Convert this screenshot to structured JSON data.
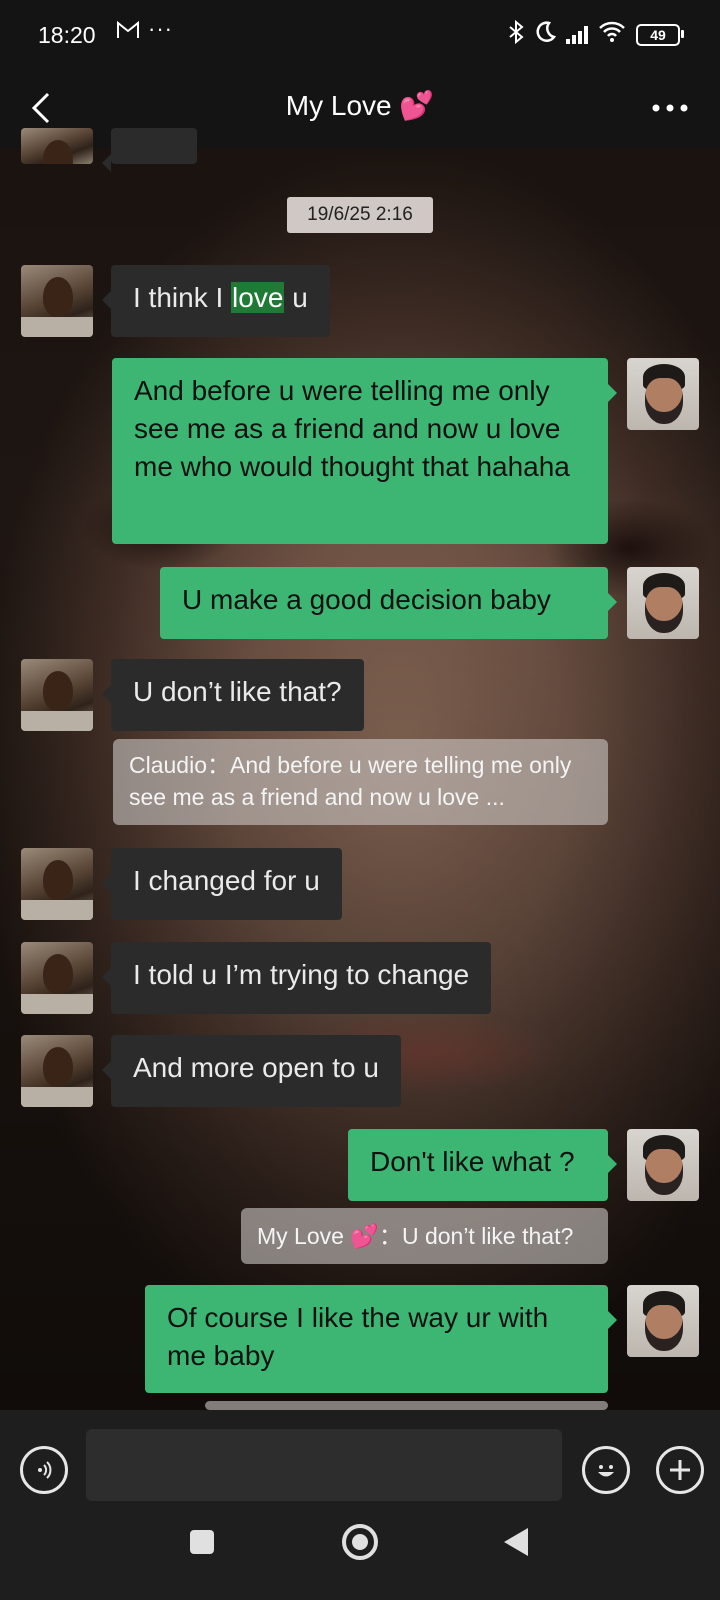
{
  "status_bar": {
    "time": "18:20",
    "notification_icon": "gmail-icon",
    "more_dots": "···",
    "battery": "49"
  },
  "header": {
    "title": "My Love 💕",
    "back_icon": "chevron-left-icon",
    "more_icon": "more-dots-icon"
  },
  "timestamp": "19/6/25 2:16",
  "messages": {
    "m1": {
      "pre": "I think I ",
      "highlight": "love",
      "post": " u"
    },
    "m2": "And before u were telling me only see me as a friend and now u love me who would thought that hahaha",
    "m3": "U make a good decision baby",
    "m4": "U don’t like that?",
    "q1": "Claudio：And before u were telling me only see me as a friend and now u love ...",
    "m5": "I changed for u",
    "m6": "I told u I’m trying to change",
    "m7": "And more open to u",
    "m8": "Don't like what ?",
    "q2": "My Love 💕：U don’t like that?",
    "m9": "Of course I like the way ur with me baby"
  },
  "input": {
    "value": "",
    "placeholder": ""
  },
  "colors": {
    "outgoing_bubble": "#3cb672",
    "incoming_bubble": "#2b2b2b",
    "highlight": "#1e7a34",
    "bar_background": "#141414"
  }
}
